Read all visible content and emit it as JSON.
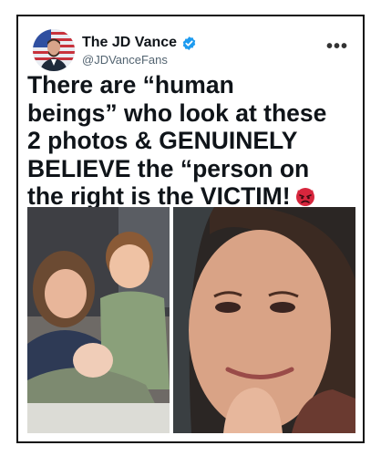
{
  "account": {
    "display_name": "The JD Vance",
    "handle": "@JDVanceFans",
    "verified": true,
    "avatar_icon": "profile-avatar"
  },
  "menu_icon": "more-options",
  "tweet": {
    "lines": [
      "There are “human",
      "beings” who look at these",
      "2 photos & GENUINELY",
      "BELIEVE the “person on",
      "the right is the VICTIM!"
    ],
    "emoji": "angry-face-emoji"
  },
  "media": [
    {
      "icon": "children-photo"
    },
    {
      "icon": "woman-photo"
    }
  ],
  "colors": {
    "verified_blue": "#1d9bf0",
    "text": "#0f1419",
    "handle_grey": "#536471"
  }
}
